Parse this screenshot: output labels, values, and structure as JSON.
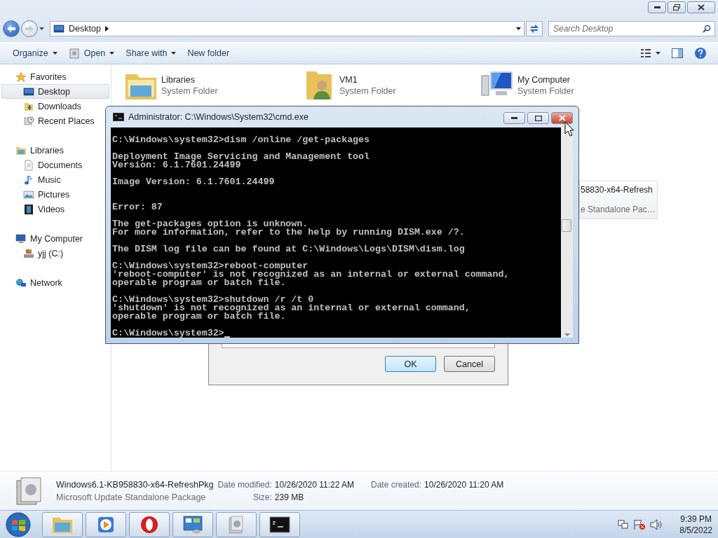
{
  "explorer": {
    "address": {
      "location": "Desktop"
    },
    "search": {
      "placeholder": "Search Desktop"
    },
    "toolbar": [
      {
        "label": "Organize",
        "dropdown": true
      },
      {
        "label": "Open",
        "dropdown": true
      },
      {
        "label": "Share with",
        "dropdown": true
      },
      {
        "label": "New folder",
        "dropdown": false
      }
    ],
    "navigation": [
      {
        "label": "Favorites",
        "selected": false,
        "children": [
          {
            "label": "Desktop",
            "selected": true
          },
          {
            "label": "Downloads",
            "selected": false
          },
          {
            "label": "Recent Places",
            "selected": false
          }
        ]
      },
      {
        "label": "Libraries",
        "selected": false,
        "children": [
          {
            "label": "Documents",
            "selected": false
          },
          {
            "label": "Music",
            "selected": false
          },
          {
            "label": "Pictures",
            "selected": false
          },
          {
            "label": "Videos",
            "selected": false
          }
        ]
      },
      {
        "label": "My Computer",
        "selected": false,
        "children": [
          {
            "label": "yjj (C:)",
            "selected": false
          }
        ]
      },
      {
        "label": "Network",
        "selected": false
      }
    ],
    "items": [
      {
        "name": "Libraries",
        "type": "System Folder"
      },
      {
        "name": "VM1",
        "type": "System Folder"
      },
      {
        "name": "My Computer",
        "type": "System Folder"
      }
    ],
    "partial_item": {
      "name": "58830-x64-Refresh",
      "type": "e Standalone Pac…"
    },
    "details": {
      "name": "Windows6.1-KB958830-x64-RefreshPkg",
      "type": "Microsoft Update Standalone Package",
      "fields": [
        {
          "label": "Date modified:",
          "value": "10/26/2020 11:22 AM"
        },
        {
          "label": "Date created:",
          "value": "10/26/2020 11:20 AM"
        },
        {
          "label": "Size:",
          "value": "239 MB"
        }
      ]
    }
  },
  "dialog": {
    "buttons": [
      {
        "label": "OK",
        "default": true
      },
      {
        "label": "Cancel",
        "default": false
      }
    ]
  },
  "console": {
    "title": "Administrator: C:\\Windows\\System32\\cmd.exe",
    "blocks": [
      {
        "extra_gap": false,
        "lines": [
          "C:\\Windows\\system32>dism /online /get-packages"
        ]
      },
      {
        "extra_gap": false,
        "lines": [
          "Deployment Image Servicing and Management tool",
          "Version: 6.1.7601.24499"
        ]
      },
      {
        "extra_gap": false,
        "lines": [
          "Image Version: 6.1.7601.24499"
        ]
      },
      {
        "extra_gap": true,
        "lines": [
          "Error: 87"
        ]
      },
      {
        "extra_gap": false,
        "lines": [
          "The get-packages option is unknown.",
          "For more information, refer to the help by running DISM.exe /?."
        ]
      },
      {
        "extra_gap": false,
        "lines": [
          "The DISM log file can be found at C:\\Windows\\Logs\\DISM\\dism.log"
        ]
      },
      {
        "extra_gap": false,
        "lines": [
          "C:\\Windows\\system32>reboot-computer",
          "'reboot-computer' is not recognized as an internal or external command,",
          "operable program or batch file."
        ]
      },
      {
        "extra_gap": false,
        "lines": [
          "C:\\Windows\\system32>shutdown /r /t 0",
          "'shutdown' is not recognized as an internal or external command,",
          "operable program or batch file."
        ]
      },
      {
        "extra_gap": false,
        "lines": [
          "C:\\Windows\\system32>"
        ]
      }
    ]
  },
  "taskbar": {
    "clock": {
      "time": "9:39 PM",
      "date": "8/5/2022"
    }
  }
}
